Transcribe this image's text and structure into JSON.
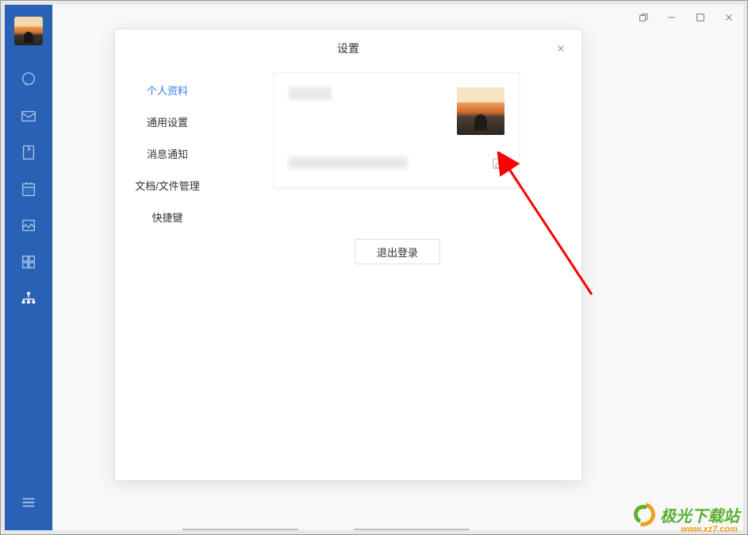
{
  "sidebar": {
    "icons": [
      "chat-icon",
      "mail-icon",
      "docs-icon",
      "calendar-icon",
      "gallery-icon",
      "apps-icon",
      "org-icon"
    ]
  },
  "settings": {
    "title": "设置",
    "tabs": [
      "个人资料",
      "通用设置",
      "消息通知",
      "文档/文件管理",
      "快捷键"
    ],
    "logout_label": "退出登录"
  },
  "watermark": {
    "name": "极光下载站",
    "url": "www.xz7.com"
  }
}
